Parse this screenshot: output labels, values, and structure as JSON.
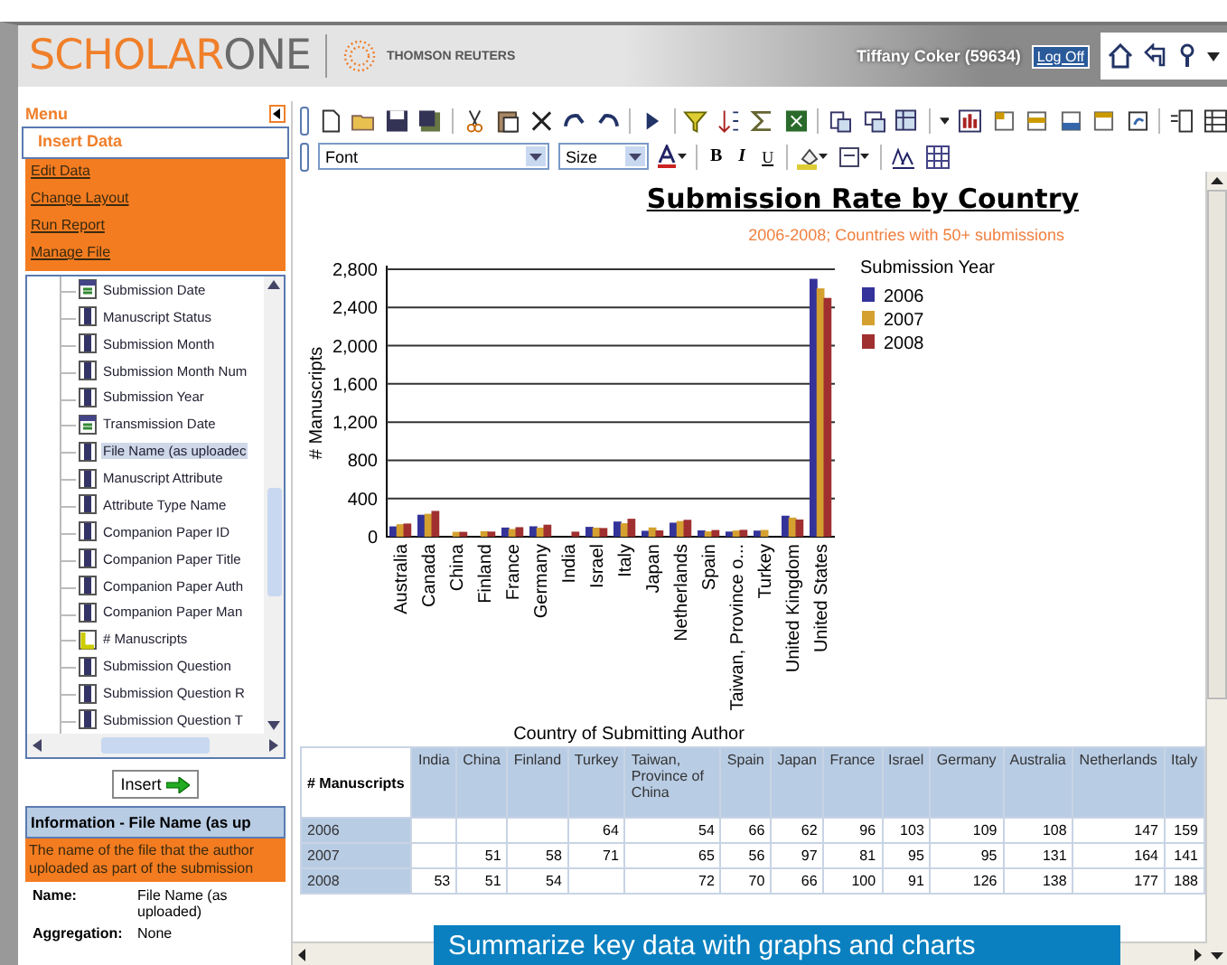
{
  "header": {
    "logo_accent": "SCHOLAR",
    "logo_rest": "ONE",
    "publisher": "THOMSON REUTERS",
    "user": "Tiffany Coker (59634)",
    "logoff": "Log Off"
  },
  "sidebar": {
    "title": "Menu",
    "menu_items": [
      {
        "label": "Insert Data",
        "selected": true
      },
      {
        "label": "Edit Data",
        "selected": false
      },
      {
        "label": "Change Layout",
        "selected": false
      },
      {
        "label": "Run Report",
        "selected": false
      },
      {
        "label": "Manage File",
        "selected": false
      }
    ],
    "tree_items": [
      {
        "label": "Submission Date",
        "kind": "date",
        "selected": false
      },
      {
        "label": "Manuscript Status",
        "kind": "dimension",
        "selected": false
      },
      {
        "label": "Submission Month",
        "kind": "dimension",
        "selected": false
      },
      {
        "label": "Submission Month Num",
        "kind": "dimension",
        "selected": false
      },
      {
        "label": "Submission Year",
        "kind": "dimension",
        "selected": false
      },
      {
        "label": "Transmission Date",
        "kind": "date",
        "selected": false
      },
      {
        "label": "File Name (as uploadec",
        "kind": "dimension",
        "selected": true
      },
      {
        "label": "Manuscript Attribute",
        "kind": "dimension",
        "selected": false
      },
      {
        "label": "Attribute Type Name",
        "kind": "dimension",
        "selected": false
      },
      {
        "label": "Companion Paper ID",
        "kind": "dimension",
        "selected": false
      },
      {
        "label": "Companion Paper Title",
        "kind": "dimension",
        "selected": false
      },
      {
        "label": "Companion Paper Auth",
        "kind": "dimension",
        "selected": false
      },
      {
        "label": "Companion Paper Man",
        "kind": "dimension",
        "selected": false
      },
      {
        "label": "# Manuscripts",
        "kind": "measure",
        "selected": false
      },
      {
        "label": "Submission Question",
        "kind": "dimension",
        "selected": false
      },
      {
        "label": "Submission Question R",
        "kind": "dimension",
        "selected": false
      },
      {
        "label": "Submission Question T",
        "kind": "dimension",
        "selected": false
      }
    ],
    "insert_button": "Insert",
    "info_title": "Information - File Name (as up",
    "info_description": "The name of the file that the author uploaded as part of the submission",
    "info_fields": [
      {
        "label": "Name:",
        "value": "File Name (as uploaded)"
      },
      {
        "label": "Aggregation:",
        "value": "None"
      }
    ]
  },
  "toolbar": {
    "font": "Font",
    "size": "Size",
    "bold": "B",
    "italic": "I",
    "underline": "U"
  },
  "report": {
    "title": "Submission Rate by Country",
    "subtitle": "2006-2008; Countries with 50+ submissions",
    "chart_data": {
      "type": "bar",
      "xlabel": "Country of Submitting Author",
      "ylabel": "# Manuscripts",
      "grid": true,
      "legend": {
        "title": "Submission Year"
      },
      "categories": [
        "Australia",
        "Canada",
        "China",
        "Finland",
        "France",
        "Germany",
        "India",
        "Israel",
        "Italy",
        "Japan",
        "Netherlands",
        "Spain",
        "Taiwan, Province o...",
        "Turkey",
        "United Kingdom",
        "United States"
      ],
      "series": [
        {
          "name": "2006",
          "color": "#333399",
          "values": [
            108,
            230,
            null,
            null,
            96,
            109,
            null,
            103,
            159,
            62,
            147,
            66,
            54,
            64,
            220,
            2700
          ]
        },
        {
          "name": "2007",
          "color": "#d4a030",
          "values": [
            131,
            240,
            51,
            58,
            81,
            95,
            null,
            95,
            141,
            97,
            164,
            56,
            65,
            71,
            200,
            2600
          ]
        },
        {
          "name": "2008",
          "color": "#a03030",
          "values": [
            138,
            270,
            51,
            54,
            100,
            126,
            53,
            91,
            188,
            66,
            177,
            70,
            72,
            null,
            180,
            2500
          ]
        }
      ],
      "ylim": [
        0,
        2800
      ],
      "yticks": [
        {
          "value": 0,
          "label": "0"
        },
        {
          "value": 400,
          "label": "400"
        },
        {
          "value": 800,
          "label": "800"
        },
        {
          "value": 1200,
          "label": "1,200"
        },
        {
          "value": 1600,
          "label": "1,600"
        },
        {
          "value": 2000,
          "label": "2,000"
        },
        {
          "value": 2400,
          "label": "2,400"
        },
        {
          "value": 2800,
          "label": "2,800"
        }
      ]
    },
    "table": {
      "corner": "# Manuscripts",
      "columns": [
        "India",
        "China",
        "Finland",
        "Turkey",
        "Taiwan, Province of China",
        "Spain",
        "Japan",
        "France",
        "Israel",
        "Germany",
        "Australia",
        "Netherlands",
        "Italy"
      ],
      "rows": [
        {
          "label": "2006",
          "cells": [
            "",
            "",
            "",
            "64",
            "54",
            "66",
            "62",
            "96",
            "103",
            "109",
            "108",
            "147",
            "159"
          ]
        },
        {
          "label": "2007",
          "cells": [
            "",
            "51",
            "58",
            "71",
            "65",
            "56",
            "97",
            "81",
            "95",
            "95",
            "131",
            "164",
            "141"
          ]
        },
        {
          "label": "2008",
          "cells": [
            "53",
            "51",
            "54",
            "",
            "72",
            "70",
            "66",
            "100",
            "91",
            "126",
            "138",
            "177",
            "188"
          ]
        }
      ]
    }
  },
  "caption": "Summarize key data with graphs and charts"
}
